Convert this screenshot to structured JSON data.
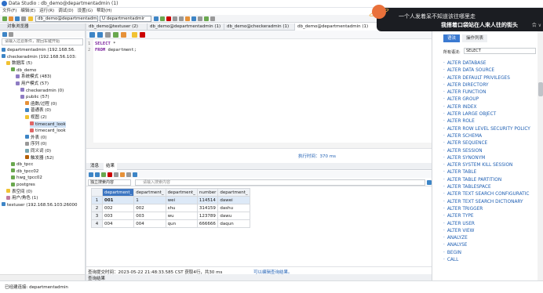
{
  "window": {
    "title": "Data Studio : db_demo@departmentadmin (1)"
  },
  "menu": [
    "文件(F)",
    "编辑(E)",
    "运行(R)",
    "调试(D)",
    "设置(G)",
    "帮助(H)"
  ],
  "toolbar": {
    "connection_tab": "db_demo@departmentadmin",
    "connection_tab2": "U  departmentadmir",
    "extra": "1"
  },
  "navigator": {
    "title": "对象浏览器",
    "search_placeholder": "请输入过滤条件，按回车键开始",
    "tree": [
      {
        "label": "departmentadmin (192.168.56.",
        "level": 0,
        "icon": "server-icon"
      },
      {
        "label": "checkeradmin (192.168.56.103:",
        "level": 0,
        "icon": "server-icon"
      },
      {
        "label": "数据库 (5)",
        "level": 1,
        "icon": "folder-icon"
      },
      {
        "label": "db_demo",
        "level": 2,
        "icon": "database-icon"
      },
      {
        "label": "系统模式 (483)",
        "level": 3,
        "icon": "schema-icon"
      },
      {
        "label": "用户模式 (57)",
        "level": 3,
        "icon": "schema-icon"
      },
      {
        "label": "checkeradmin (0)",
        "level": 4,
        "icon": "schema-icon"
      },
      {
        "label": "public (57)",
        "level": 4,
        "icon": "schema-icon"
      },
      {
        "label": "函数/过程 (0)",
        "level": 5,
        "icon": "function-icon"
      },
      {
        "label": "普通表 (0)",
        "level": 5,
        "icon": "table-icon"
      },
      {
        "label": "视图 (2)",
        "level": 5,
        "icon": "folder-icon"
      },
      {
        "label": "timecard_look",
        "level": 6,
        "icon": "view-icon",
        "selected": true
      },
      {
        "label": "timecard_look",
        "level": 6,
        "icon": "view-icon"
      },
      {
        "label": "外表 (0)",
        "level": 5,
        "icon": "table-icon"
      },
      {
        "label": "序列 (0)",
        "level": 5,
        "icon": "sequence-icon"
      },
      {
        "label": "同义词 (0)",
        "level": 5,
        "icon": "synonym-icon"
      },
      {
        "label": "触发器 (52)",
        "level": 5,
        "icon": "trigger-icon"
      },
      {
        "label": "db_tpcc",
        "level": 2,
        "icon": "database-icon"
      },
      {
        "label": "db_tpcc02",
        "level": 2,
        "icon": "database-icon"
      },
      {
        "label": "hwg_tpcc02",
        "level": 2,
        "icon": "database-icon"
      },
      {
        "label": "postgres",
        "level": 2,
        "icon": "database-icon"
      },
      {
        "label": "表空间 (0)",
        "level": 1,
        "icon": "folder-icon"
      },
      {
        "label": "用户/角色 (1)",
        "level": 1,
        "icon": "user-icon"
      },
      {
        "label": "testuser (192.168.56.103:26000",
        "level": 0,
        "icon": "server-icon"
      }
    ]
  },
  "editor": {
    "tabs": [
      {
        "label": "db_demo@testuser (2)",
        "active": false
      },
      {
        "label": "db_demo@departmentadmin (1)",
        "active": false
      },
      {
        "label": "db_demo@checkeradmin (1)",
        "active": false
      },
      {
        "label": "db_demo@departmentadmin (1)",
        "active": true
      }
    ],
    "lines": [
      {
        "num": "1",
        "kw": "SELECT",
        "rest": " *"
      },
      {
        "num": "2",
        "kw": "FROM",
        "rest": " department;"
      }
    ],
    "exec_time": "执行时间：370 ms"
  },
  "results": {
    "tabs": [
      "消息",
      "结果"
    ],
    "filter_select": "独立搜索内容",
    "filter_placeholder": "请输入搜索内容",
    "columns": [
      "department_",
      "department_",
      "department_",
      "number",
      "department_"
    ],
    "rows": [
      [
        "1",
        "001",
        "1",
        "wei",
        "114514",
        "dawei"
      ],
      [
        "2",
        "002",
        "002",
        "shu",
        "314159",
        "dashu"
      ],
      [
        "3",
        "003",
        "003",
        "wu",
        "123789",
        "dawu"
      ],
      [
        "4",
        "004",
        "004",
        "qun",
        "666666",
        "daqun"
      ]
    ],
    "status_left": "查询提交时间：2023-05-22 21:48:33.585 CST    获取4行，共30 ms",
    "status_right": "可以编辑查询结果。",
    "bottom_tab": "查询结果"
  },
  "syntax_panel": {
    "tabs": [
      "语法",
      "操作列表"
    ],
    "filter_label": "所有语法:",
    "filter_value": "SELECT",
    "items": [
      "ALTER DATABASE",
      "ALTER DATA SOURCE",
      "ALTER DEFAULT PRIVILEGES",
      "ALTER DIRECTORY",
      "ALTER FUNCTION",
      "ALTER GROUP",
      "ALTER INDEX",
      "ALTER LARGE OBJECT",
      "ALTER ROLE",
      "ALTER ROW LEVEL SECURITY POLICY",
      "ALTER SCHEMA",
      "ALTER SEQUENCE",
      "ALTER SESSION",
      "ALTER SYNONYM",
      "ALTER SYSTEM KILL SESSION",
      "ALTER TABLE",
      "ALTER TABLE PARTITION",
      "ALTER TABLESPACE",
      "ALTER TEXT SEARCH CONFIGURATIC",
      "ALTER TEXT SEARCH DICTIONARY",
      "ALTER TRIGGER",
      "ALTER TYPE",
      "ALTER USER",
      "ALTER VIEW",
      "ANALYZE",
      "ANALYSE",
      "BEGIN",
      "CALL"
    ]
  },
  "statusbar": {
    "text": "已经建连接:  departmentadmin"
  },
  "overlay": {
    "line1": "一个人发着呆不知道该往哪里走",
    "line2": "我搭着口袋站在人来人往的街头",
    "suffix": "合 ∨"
  },
  "colors": {
    "accent": "#3b7ad1",
    "link": "#1f5fb3",
    "selection": "#cfe1f5"
  }
}
